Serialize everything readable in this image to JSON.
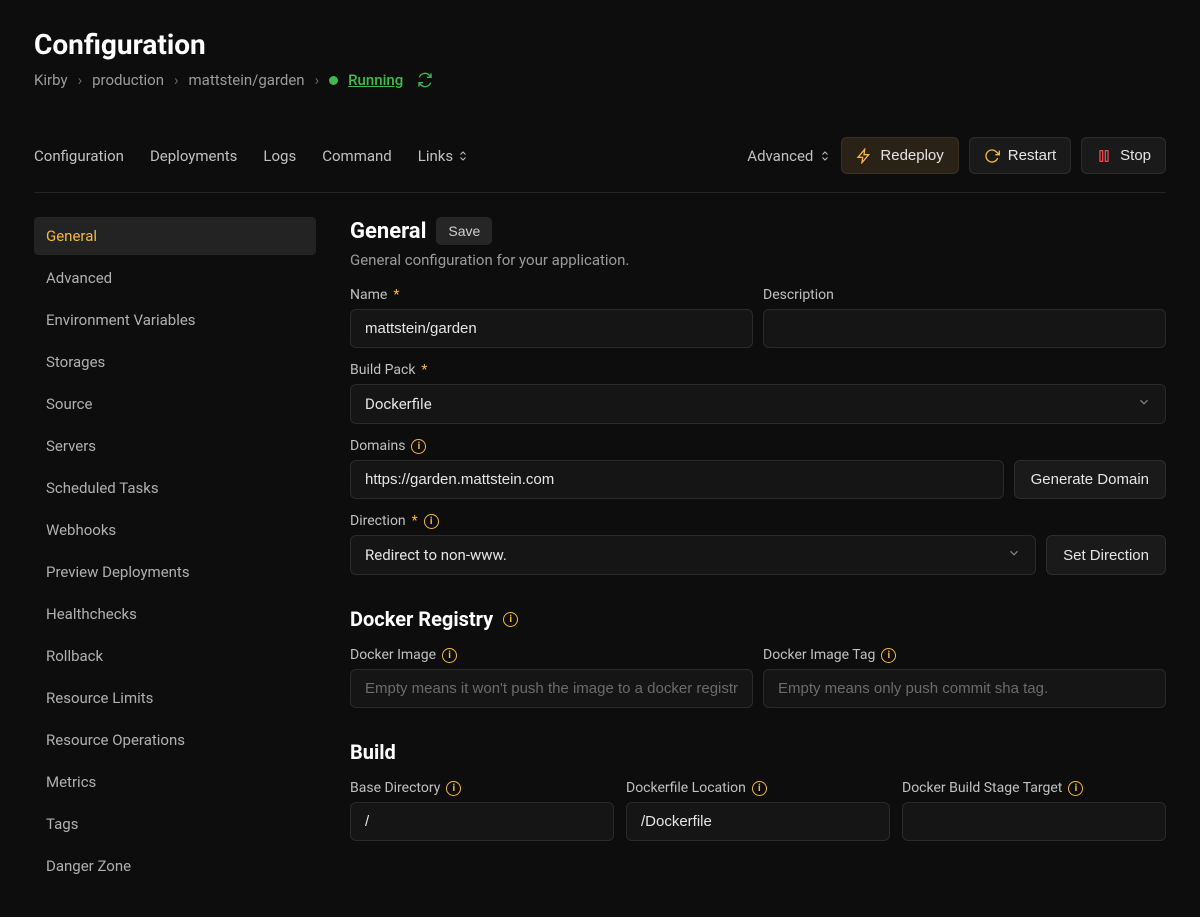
{
  "page_title": "Configuration",
  "breadcrumb": {
    "project": "Kirby",
    "env": "production",
    "repo": "mattstein/garden",
    "status": "Running"
  },
  "tabs": [
    "Configuration",
    "Deployments",
    "Logs",
    "Command",
    "Links"
  ],
  "advanced_label": "Advanced",
  "actions": {
    "redeploy": "Redeploy",
    "restart": "Restart",
    "stop": "Stop"
  },
  "sidebar": {
    "items": [
      "General",
      "Advanced",
      "Environment Variables",
      "Storages",
      "Source",
      "Servers",
      "Scheduled Tasks",
      "Webhooks",
      "Preview Deployments",
      "Healthchecks",
      "Rollback",
      "Resource Limits",
      "Resource Operations",
      "Metrics",
      "Tags",
      "Danger Zone"
    ]
  },
  "sections": {
    "general": {
      "title": "General",
      "save": "Save",
      "desc": "General configuration for your application.",
      "name_label": "Name",
      "name_value": "mattstein/garden",
      "description_label": "Description",
      "description_value": "",
      "buildpack_label": "Build Pack",
      "buildpack_value": "Dockerfile",
      "domains_label": "Domains",
      "domains_value": "https://garden.mattstein.com",
      "generate_domain": "Generate Domain",
      "direction_label": "Direction",
      "direction_value": "Redirect to non-www.",
      "set_direction": "Set Direction"
    },
    "docker": {
      "title": "Docker Registry",
      "image_label": "Docker Image",
      "image_placeholder": "Empty means it won't push the image to a docker registry.",
      "tag_label": "Docker Image Tag",
      "tag_placeholder": "Empty means only push commit sha tag."
    },
    "build": {
      "title": "Build",
      "base_dir_label": "Base Directory",
      "base_dir_value": "/",
      "dockerfile_loc_label": "Dockerfile Location",
      "dockerfile_loc_value": "/Dockerfile",
      "stage_target_label": "Docker Build Stage Target",
      "stage_target_value": ""
    }
  }
}
